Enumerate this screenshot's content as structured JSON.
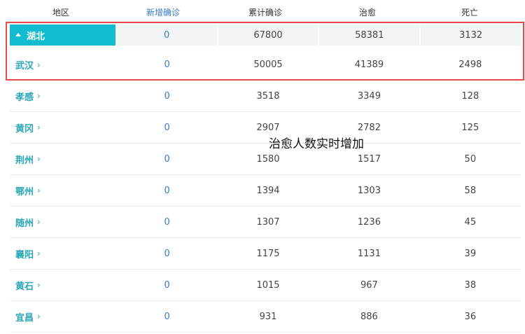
{
  "header": {
    "region": "地区",
    "new_confirmed": "新增确诊",
    "total_confirmed": "累计确诊",
    "cured": "治愈",
    "deaths": "死亡"
  },
  "province": {
    "name": "湖北",
    "new": "0",
    "total": "67800",
    "cured": "58381",
    "deaths": "3132"
  },
  "cities": [
    {
      "name": "武汉",
      "new": "0",
      "total": "50005",
      "cured": "41389",
      "deaths": "2498"
    },
    {
      "name": "孝感",
      "new": "0",
      "total": "3518",
      "cured": "3349",
      "deaths": "128"
    },
    {
      "name": "黄冈",
      "new": "0",
      "total": "2907",
      "cured": "2782",
      "deaths": "125"
    },
    {
      "name": "荆州",
      "new": "0",
      "total": "1580",
      "cured": "1517",
      "deaths": "50"
    },
    {
      "name": "鄂州",
      "new": "0",
      "total": "1394",
      "cured": "1303",
      "deaths": "58"
    },
    {
      "name": "随州",
      "new": "0",
      "total": "1307",
      "cured": "1236",
      "deaths": "45"
    },
    {
      "name": "襄阳",
      "new": "0",
      "total": "1175",
      "cured": "1131",
      "deaths": "39"
    },
    {
      "name": "黄石",
      "new": "0",
      "total": "1015",
      "cured": "967",
      "deaths": "38"
    },
    {
      "name": "宜昌",
      "new": "0",
      "total": "931",
      "cured": "886",
      "deaths": "36"
    }
  ],
  "icons": {
    "expand": "triangle-up-icon",
    "row_chevron": "chevron-right-icon"
  },
  "colors": {
    "accent": "#12bcd0",
    "link": "#29a7b8",
    "new_blue": "#3a7ac8",
    "highlight_box": "#e84a4a"
  },
  "annotation": "治愈人数实时增加"
}
